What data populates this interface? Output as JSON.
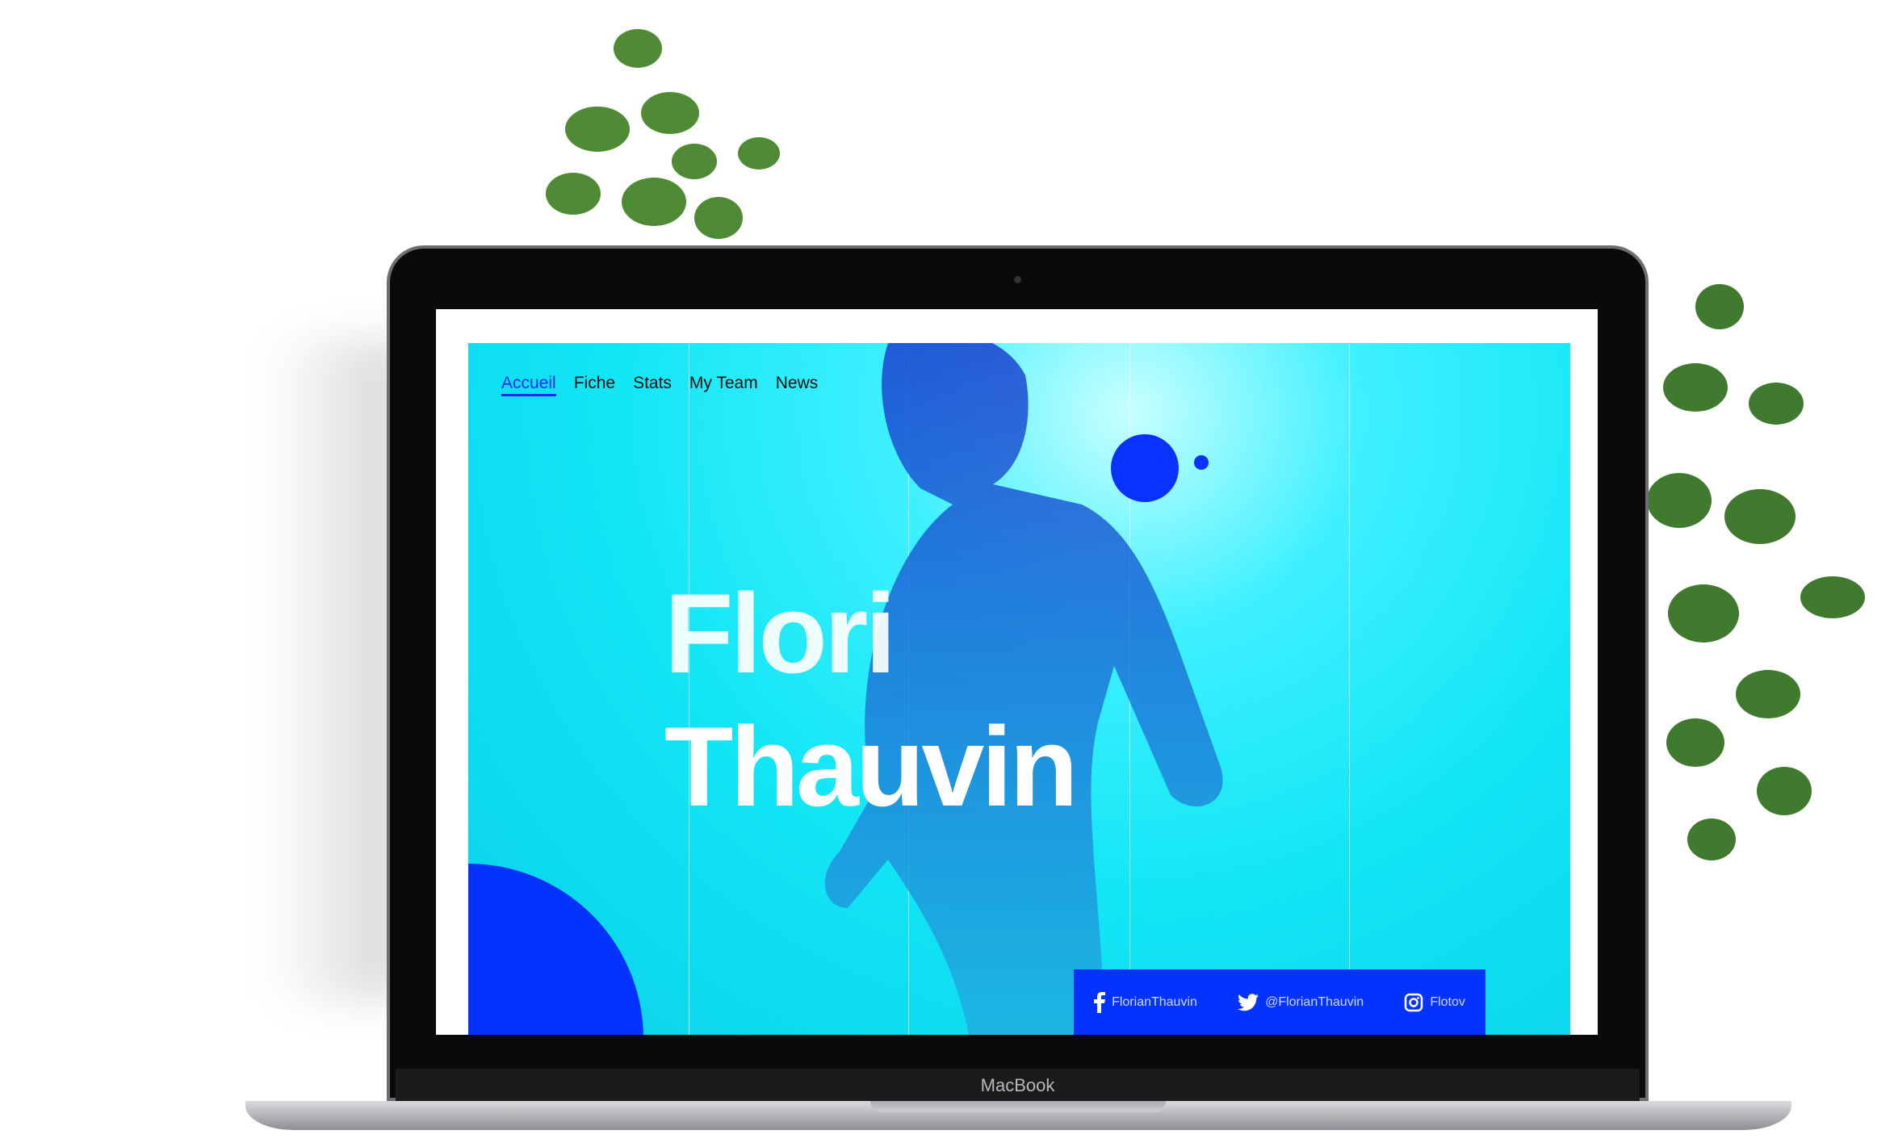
{
  "nav": {
    "items": [
      "Accueil",
      "Fiche",
      "Stats",
      "My Team",
      "News"
    ],
    "active": "Accueil"
  },
  "hero": {
    "first_name": "Flori",
    "last_name": "Thauvin"
  },
  "social": [
    {
      "icon": "facebook-icon",
      "label": "FlorianThauvin"
    },
    {
      "icon": "twitter-icon",
      "label": "@FlorianThauvin"
    },
    {
      "icon": "instagram-icon",
      "label": "Flotov"
    }
  ],
  "device": {
    "brand": "MacBook"
  },
  "colors": {
    "accent": "#0433ff",
    "background": "#12e6f5"
  }
}
